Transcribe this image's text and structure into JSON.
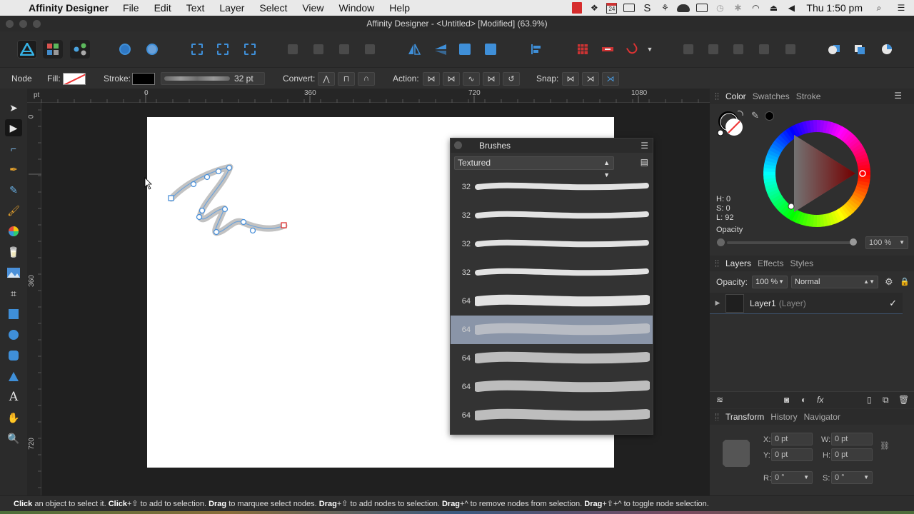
{
  "menubar": {
    "app_name": "Affinity Designer",
    "items": [
      "File",
      "Edit",
      "Text",
      "Layer",
      "Select",
      "View",
      "Window",
      "Help"
    ],
    "calendar_day": "24",
    "clock": "Thu 1:50 pm"
  },
  "window": {
    "title": "Affinity Designer - <Untitled> [Modified] (63.9%)"
  },
  "context": {
    "tool_name": "Node",
    "fill_label": "Fill:",
    "stroke_label": "Stroke:",
    "stroke_width": "32 pt",
    "convert_label": "Convert:",
    "action_label": "Action:",
    "snap_label": "Snap:"
  },
  "rulers": {
    "unit": "pt",
    "top_ticks": [
      "0",
      "360",
      "720",
      "1080"
    ],
    "left_ticks": [
      "0",
      "360",
      "720"
    ]
  },
  "brushes": {
    "title": "Brushes",
    "category": "Textured",
    "rows": [
      {
        "size": "32"
      },
      {
        "size": "32"
      },
      {
        "size": "32"
      },
      {
        "size": "32"
      },
      {
        "size": "64"
      },
      {
        "size": "64",
        "selected": true
      },
      {
        "size": "64"
      },
      {
        "size": "64"
      },
      {
        "size": "64"
      }
    ]
  },
  "color_panel": {
    "tabs": [
      "Color",
      "Swatches",
      "Stroke"
    ],
    "h": "H: 0",
    "s": "S: 0",
    "l": "L: 92",
    "opacity_label": "Opacity",
    "opacity_value": "100 %"
  },
  "layers_panel": {
    "tabs": [
      "Layers",
      "Effects",
      "Styles"
    ],
    "opacity_label": "Opacity:",
    "opacity_value": "100 %",
    "blend_mode": "Normal",
    "layer_name": "Layer1",
    "layer_kind": "(Layer)"
  },
  "transform_panel": {
    "tabs": [
      "Transform",
      "History",
      "Navigator"
    ],
    "x_label": "X:",
    "x_value": "0 pt",
    "w_label": "W:",
    "w_value": "0 pt",
    "y_label": "Y:",
    "y_value": "0 pt",
    "h_label": "H:",
    "h_value": "0 pt",
    "r_label": "R:",
    "r_value": "0 °",
    "s_label": "S:",
    "s_value": "0 °"
  },
  "statusbar": {
    "parts": [
      {
        "b": "Click"
      },
      {
        "t": " an object to select it. "
      },
      {
        "b": "Click"
      },
      {
        "t": "+⇧ to add to selection. "
      },
      {
        "b": "Drag"
      },
      {
        "t": " to marquee select nodes. "
      },
      {
        "b": "Drag"
      },
      {
        "t": "+⇧ to add nodes to selection. "
      },
      {
        "b": "Drag"
      },
      {
        "t": "+^ to remove nodes from selection. "
      },
      {
        "b": "Drag"
      },
      {
        "t": "+⇧+^ to toggle node selection."
      }
    ]
  }
}
